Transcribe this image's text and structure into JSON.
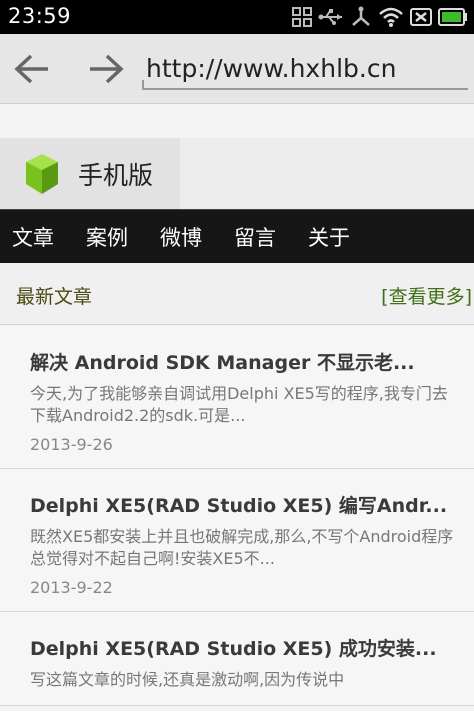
{
  "status_bar": {
    "time": "23:59"
  },
  "browser": {
    "url": "http://www.hxhlb.cn"
  },
  "site": {
    "brand_name": "手机版",
    "brand_color": "#79c11f"
  },
  "menu": {
    "items": [
      {
        "label": "文章"
      },
      {
        "label": "案例"
      },
      {
        "label": "微博"
      },
      {
        "label": "留言"
      },
      {
        "label": "关于"
      }
    ]
  },
  "section": {
    "title": "最新文章",
    "more_label": "[查看更多]"
  },
  "articles": [
    {
      "title": "解决 Android SDK Manager 不显示老...",
      "summary": "今天,为了我能够亲自调试用Delphi XE5写的程序,我专门去下载Android2.2的sdk.可是...",
      "date": "2013-9-26"
    },
    {
      "title": "Delphi XE5(RAD Studio XE5) 编写Andr...",
      "summary": "既然XE5都安装上并且也破解完成,那么,不写个Android程序总觉得对不起自己啊!安装XE5不...",
      "date": "2013-9-22"
    },
    {
      "title": "Delphi XE5(RAD Studio XE5) 成功安装...",
      "summary": "写这篇文章的时候,还真是激动啊,因为传说中",
      "date": ""
    }
  ]
}
